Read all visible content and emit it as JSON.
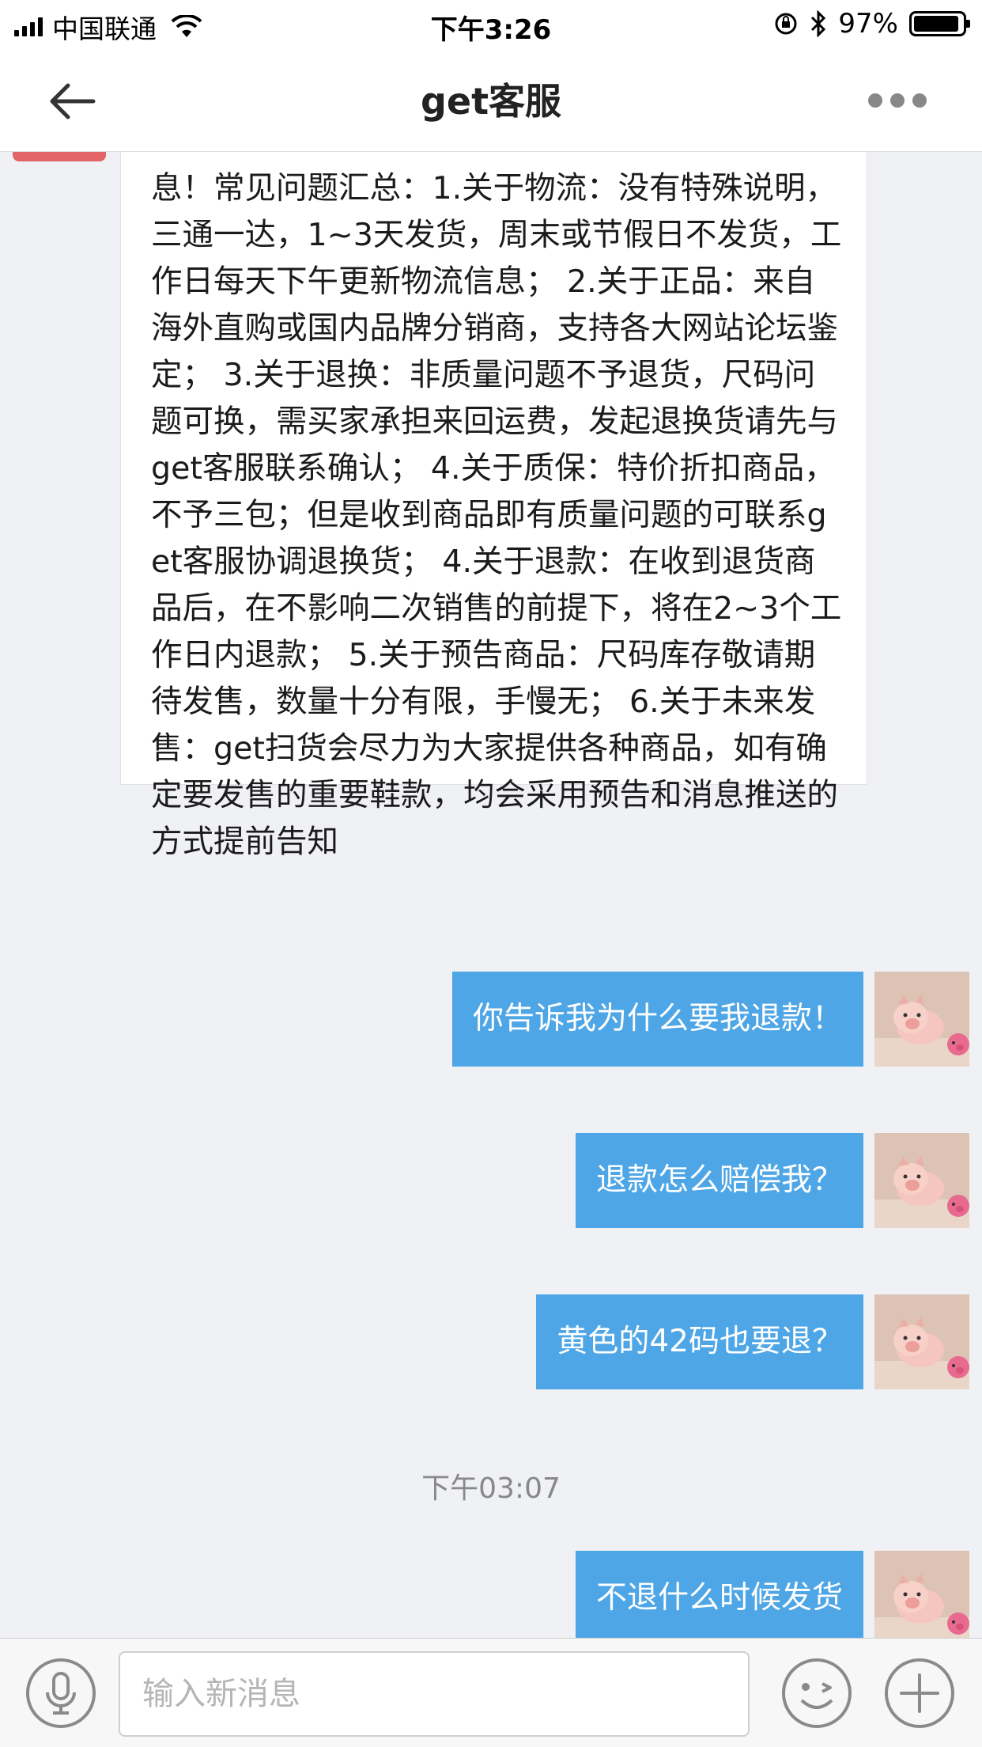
{
  "status_bar": {
    "carrier": "中国联通",
    "time": "下午3:26",
    "battery": "97%"
  },
  "nav": {
    "title": "get客服"
  },
  "agent_message": {
    "text": "息！常见问题汇总：1.关于物流：没有特殊说明，三通一达，1~3天发货，周末或节假日不发货，工作日每天下午更新物流信息； 2.关于正品：来自海外直购或国内品牌分销商，支持各大网站论坛鉴定； 3.关于退换：非质量问题不予退货，尺码问题可换，需买家承担来回运费，发起退换货请先与get客服联系确认； 4.关于质保：特价折扣商品，不予三包；但是收到商品即有质量问题的可联系get客服协调退换货； 4.关于退款：在收到退货商品后，在不影响二次销售的前提下，将在2~3个工作日内退款； 5.关于预告商品：尺码库存敬请期待发售，数量十分有限，手慢无； 6.关于未来发售：get扫货会尽力为大家提供各种商品，如有确定要发售的重要鞋款，均会采用预告和消息推送的方式提前告知"
  },
  "user_messages": [
    {
      "text": "你告诉我为什么要我退款！"
    },
    {
      "text": "退款怎么赔偿我？"
    },
    {
      "text": "黄色的42码也要退？"
    },
    {
      "text": "不退什么时候发货"
    }
  ],
  "timestamp": "下午03:07",
  "input": {
    "placeholder": "输入新消息"
  },
  "colors": {
    "user_bubble": "#4ea6e6",
    "agent_bubble": "#ffffff",
    "background": "#f0f1f5"
  }
}
